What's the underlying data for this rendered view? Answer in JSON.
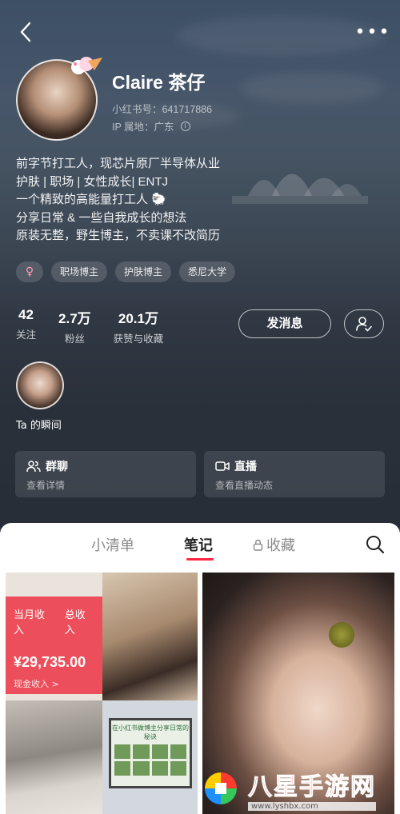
{
  "header": {
    "back_icon": "chevron-left-icon",
    "more_icon": "more-dots-icon",
    "more_label": "•••"
  },
  "profile": {
    "name": "Claire 茶仔",
    "id_label": "小红书号：641717886",
    "ip_label": "IP 属地：广东",
    "bio": [
      "前字节打工人，现芯片原厂半导体从业",
      "护肤 | 职场 | 女性成长| ENTJ",
      "一个精致的高能量打工人 🐑",
      "分享日常 & 一些自我成长的想法",
      "原装无整，野生博主，不卖课不改简历"
    ],
    "tags": {
      "gender": "♀",
      "items": [
        "职场博主",
        "护肤博主",
        "悉尼大学"
      ]
    }
  },
  "stats": [
    {
      "value": "42",
      "label": "关注"
    },
    {
      "value": "2.7万",
      "label": "粉丝"
    },
    {
      "value": "20.1万",
      "label": "获赞与收藏"
    }
  ],
  "actions": {
    "message_label": "发消息",
    "follow_icon": "user-check-icon"
  },
  "moments": {
    "label": "Ta 的瞬间"
  },
  "cards": {
    "group": {
      "title": "群聊",
      "sub": "查看详情"
    },
    "live": {
      "title": "直播",
      "sub": "查看直播动态"
    }
  },
  "tabs": {
    "list": "小清单",
    "notes": "笔记",
    "favorites": "收藏",
    "active": "笔记"
  },
  "feed": {
    "income_tab_month": "当月收入",
    "income_tab_total": "总收入",
    "income_amount": "¥29,735.00",
    "income_sub": "现金收入 >",
    "laptop_title": "在小红书做博主分享日常的秘诀"
  },
  "watermark": {
    "title": "八星手游网",
    "url": "www.lyshbx.com"
  },
  "colors": {
    "accent": "#ff2442",
    "income_bg": "#ec4f5b",
    "page_bg": "#2f3641"
  }
}
